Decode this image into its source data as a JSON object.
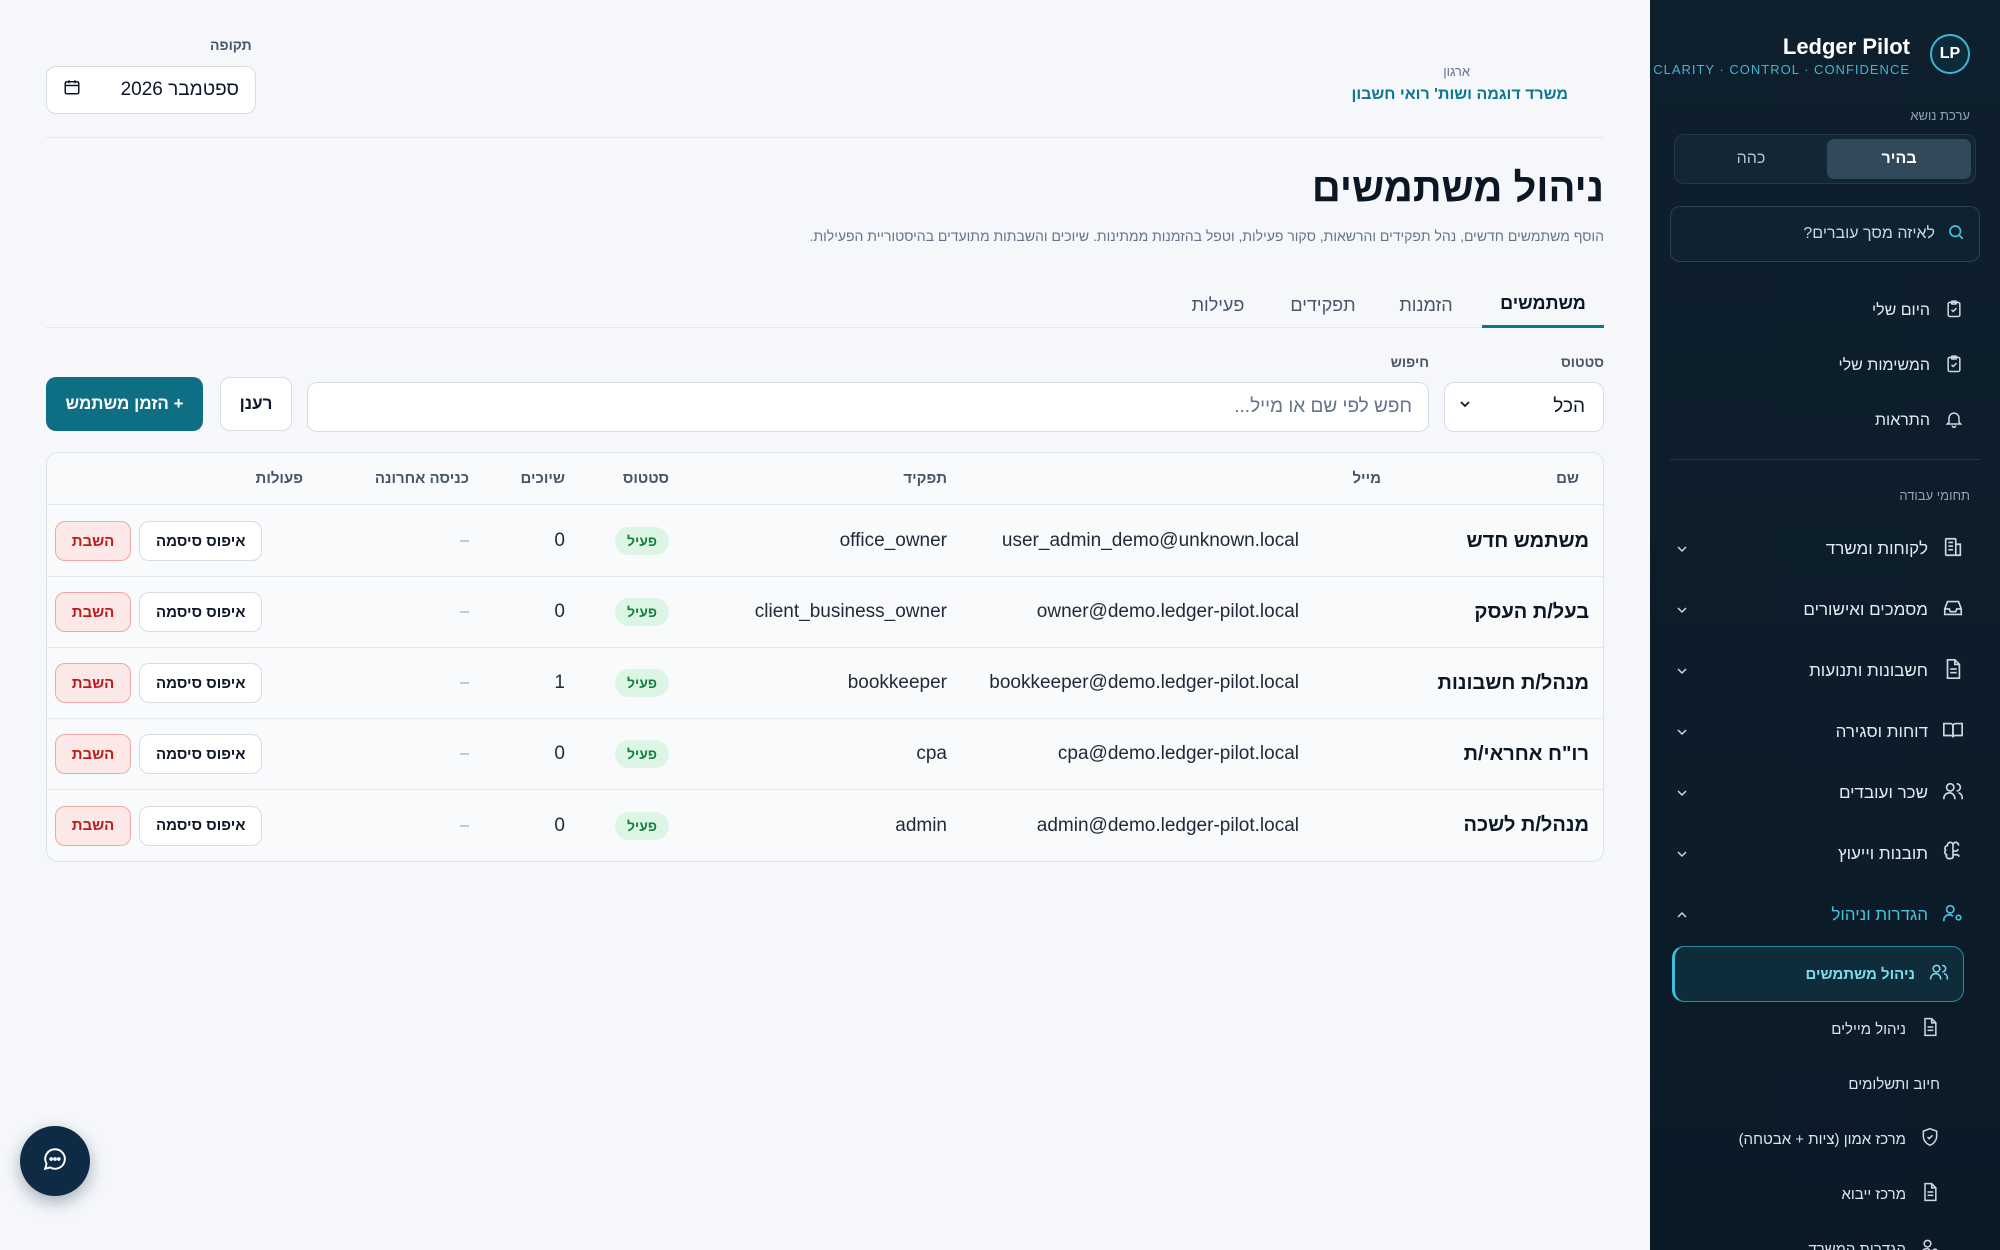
{
  "sidebar": {
    "brand_initials": "LP",
    "brand_name": "Ledger Pilot",
    "tagline": "CLARITY · CONTROL · CONFIDENCE",
    "theme_label": "ערכת נושא",
    "theme_light": "בהיר",
    "theme_dark": "כהה",
    "search_placeholder": "לאיזה מסך עוברים?",
    "top_items": [
      {
        "label": "היום שלי",
        "icon": "clipboard-check-icon"
      },
      {
        "label": "המשימות שלי",
        "icon": "clipboard-check-icon"
      },
      {
        "label": "התראות",
        "icon": "bell-icon"
      }
    ],
    "section_label": "תחומי עבודה",
    "groups": [
      {
        "label": "לקוחות ומשרד",
        "icon": "building-icon"
      },
      {
        "label": "מסמכים ואישורים",
        "icon": "inbox-icon"
      },
      {
        "label": "חשבונות ותנועות",
        "icon": "file-text-icon"
      },
      {
        "label": "דוחות וסגירה",
        "icon": "book-open-icon"
      },
      {
        "label": "שכר ועובדים",
        "icon": "users-icon"
      },
      {
        "label": "תובנות וייעוץ",
        "icon": "brain-icon"
      },
      {
        "label": "הגדרות וניהול",
        "icon": "user-cog-icon",
        "open": true
      }
    ],
    "sub_items": [
      {
        "label": "ניהול משתמשים",
        "icon": "users-icon",
        "active": true
      },
      {
        "label": "ניהול מיילים",
        "icon": "file-text-icon"
      },
      {
        "label": "חיוב ותשלומים",
        "icon": ""
      },
      {
        "label": "מרכז אמון (ציות + אבטחה)",
        "icon": "shield-check-icon"
      },
      {
        "label": "מרכז ייבוא",
        "icon": "file-text-icon"
      },
      {
        "label": "הגדרות המשרד",
        "icon": "user-cog-icon"
      }
    ]
  },
  "header": {
    "org_label": "ארגון",
    "org_name": "משרד דוגמה ושות' רואי חשבון",
    "period_label": "תקופה",
    "period_value": "ספטמבר 2026"
  },
  "page": {
    "title": "ניהול משתמשים",
    "subtitle": "הוסף משתמשים חדשים, נהל תפקידים והרשאות, סקור פעילות, וטפל בהזמנות ממתינות. שיוכים והשבתות מתועדים בהיסטוריית הפעילות."
  },
  "tabs": [
    "משתמשים",
    "הזמנות",
    "תפקידים",
    "פעילות"
  ],
  "filters": {
    "status_label": "סטטוס",
    "status_value": "הכל",
    "search_label": "חיפוש",
    "search_placeholder": "חפש לפי שם או מייל...",
    "refresh_label": "רענן",
    "invite_label": "+ הזמן משתמש"
  },
  "table": {
    "columns": [
      "שם",
      "מייל",
      "תפקיד",
      "סטטוס",
      "שיוכים",
      "כניסה אחרונה",
      "פעולות"
    ],
    "reset_label": "איפוס סיסמה",
    "disable_label": "השבת",
    "rows": [
      {
        "name": "משתמש חדש",
        "email": "user_admin_demo@unknown.local",
        "role": "office_owner",
        "status": "פעיל",
        "assignments": "0",
        "last_login": "–"
      },
      {
        "name": "בעל/ת העסק",
        "email": "owner@demo.ledger-pilot.local",
        "role": "client_business_owner",
        "status": "פעיל",
        "assignments": "0",
        "last_login": "–"
      },
      {
        "name": "מנהל/ת חשבונות",
        "email": "bookkeeper@demo.ledger-pilot.local",
        "role": "bookkeeper",
        "status": "פעיל",
        "assignments": "1",
        "last_login": "–"
      },
      {
        "name": "רו\"ח אחראי/ת",
        "email": "cpa@demo.ledger-pilot.local",
        "role": "cpa",
        "status": "פעיל",
        "assignments": "0",
        "last_login": "–"
      },
      {
        "name": "מנהל/ת לשכה",
        "email": "admin@demo.ledger-pilot.local",
        "role": "admin",
        "status": "פעיל",
        "assignments": "0",
        "last_login": "–"
      }
    ]
  },
  "chat": {
    "icon": "chat-bubble-icon"
  },
  "colors": {
    "accent": "#0e7490",
    "primary_button": "#0e6e84",
    "sidebar_bg": "#0e1f2d",
    "active_badge": "#15803d",
    "danger": "#b91c1c"
  }
}
